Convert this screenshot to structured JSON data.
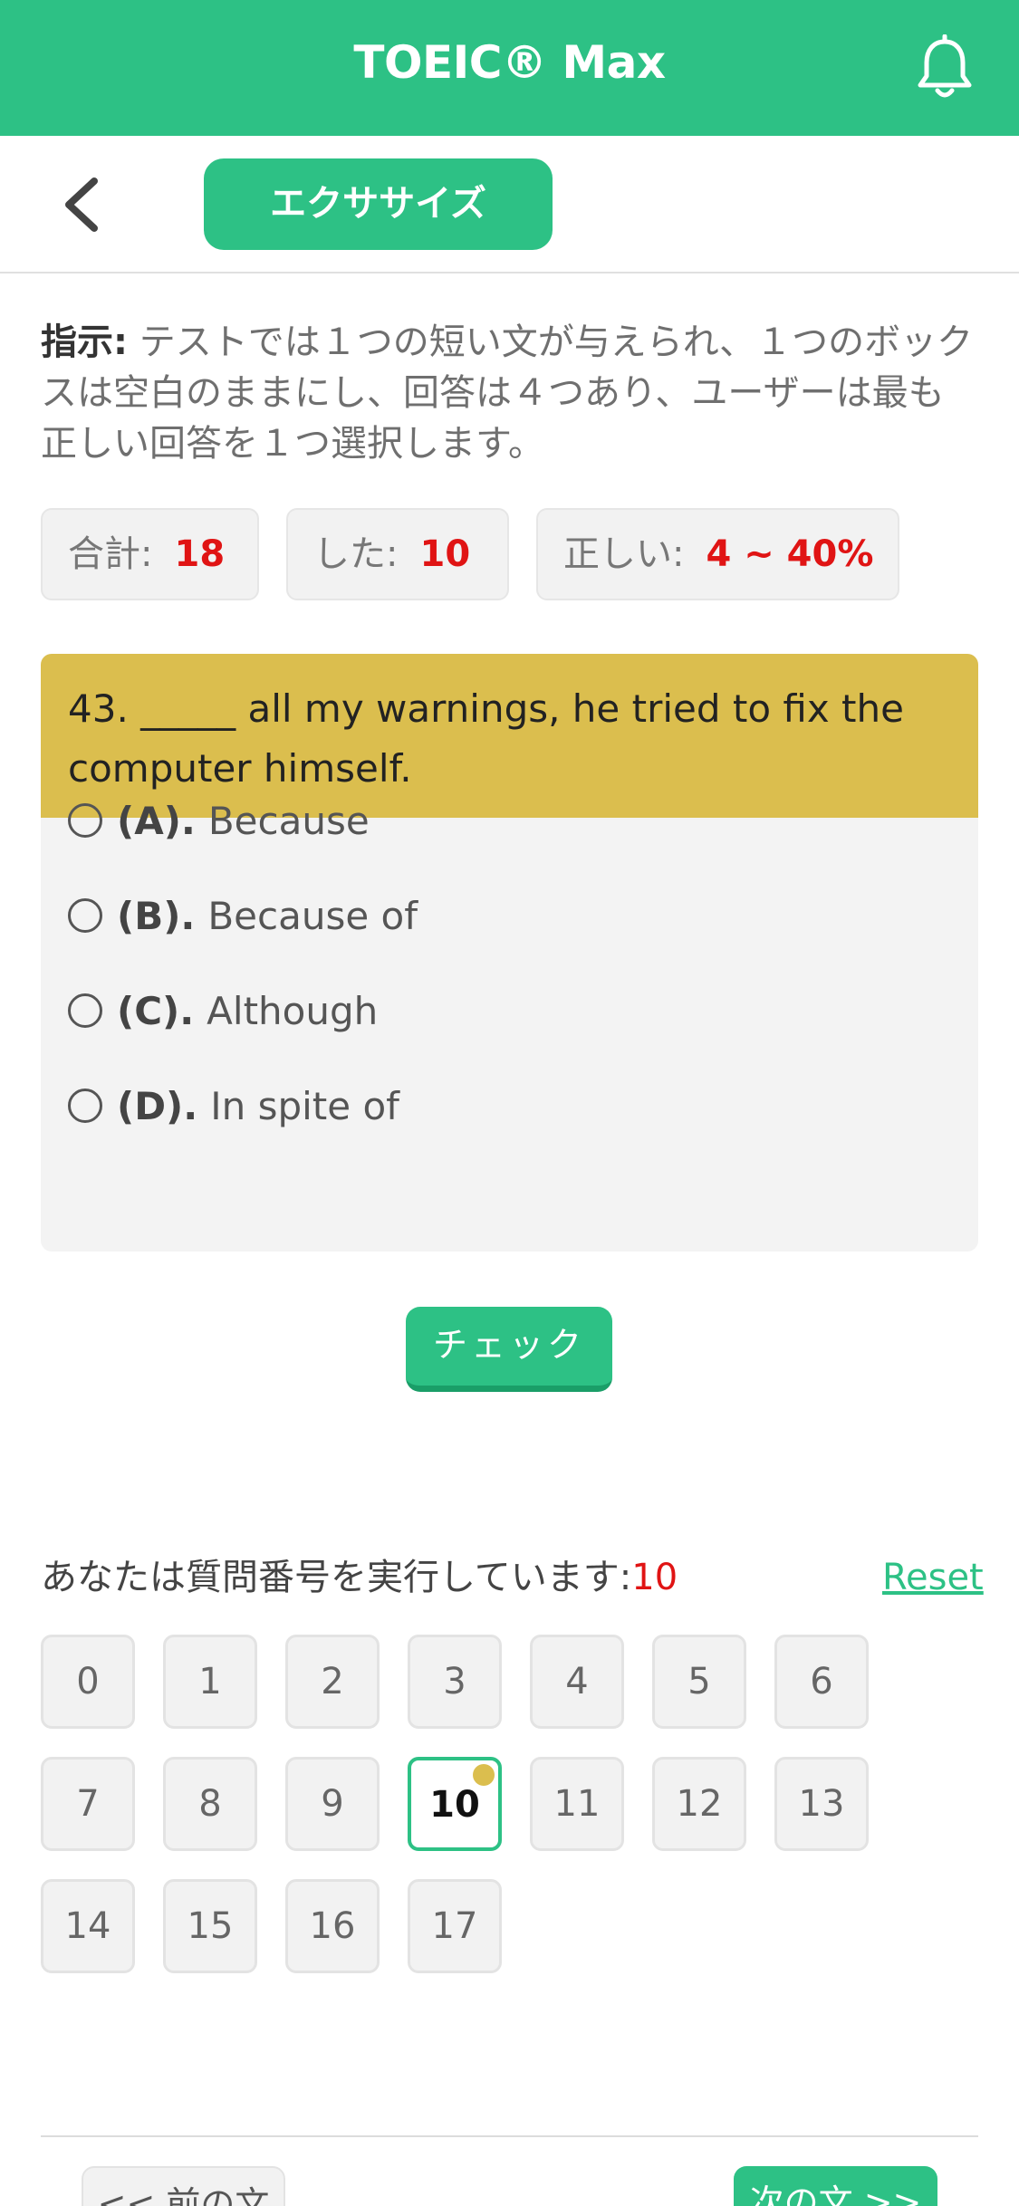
{
  "header": {
    "title": "TOEIC® Max",
    "bell_icon": "bell-icon"
  },
  "subbar": {
    "back_icon": "chevron-left-icon",
    "tab_label": "エクササイズ"
  },
  "instruction": {
    "label": "指示:",
    "text": " テストでは１つの短い文が与えられ、１つのボックスは空白のままにし、回答は４つあり、ユーザーは最も正しい回答を１つ選択します。"
  },
  "stats": {
    "total_label": "合計:",
    "total_value": "18",
    "done_label": "した:",
    "done_value": "10",
    "correct_label": "正しい:",
    "correct_value": "4 ~ 40%"
  },
  "question": {
    "text": "43. _____ all my warnings, he tried to fix the computer himself.",
    "options": [
      {
        "key": "(A).",
        "text": "Because"
      },
      {
        "key": "(B).",
        "text": "Because of"
      },
      {
        "key": "(C).",
        "text": "Although"
      },
      {
        "key": "(D).",
        "text": "In spite of"
      }
    ]
  },
  "check_label": "チェック",
  "progress": {
    "label": "あなたは質問番号を実行しています:",
    "current": "10",
    "reset_label": "Reset",
    "numbers": [
      "0",
      "1",
      "2",
      "3",
      "4",
      "5",
      "6",
      "7",
      "8",
      "9",
      "10",
      "11",
      "12",
      "13",
      "14",
      "15",
      "16",
      "17"
    ]
  },
  "nav": {
    "prev_label": "<< 前の文",
    "next_label": "次の文 >>"
  },
  "colors": {
    "accent": "#2dc185",
    "question_bg": "#dbbe4e",
    "value_red": "#e01414"
  }
}
